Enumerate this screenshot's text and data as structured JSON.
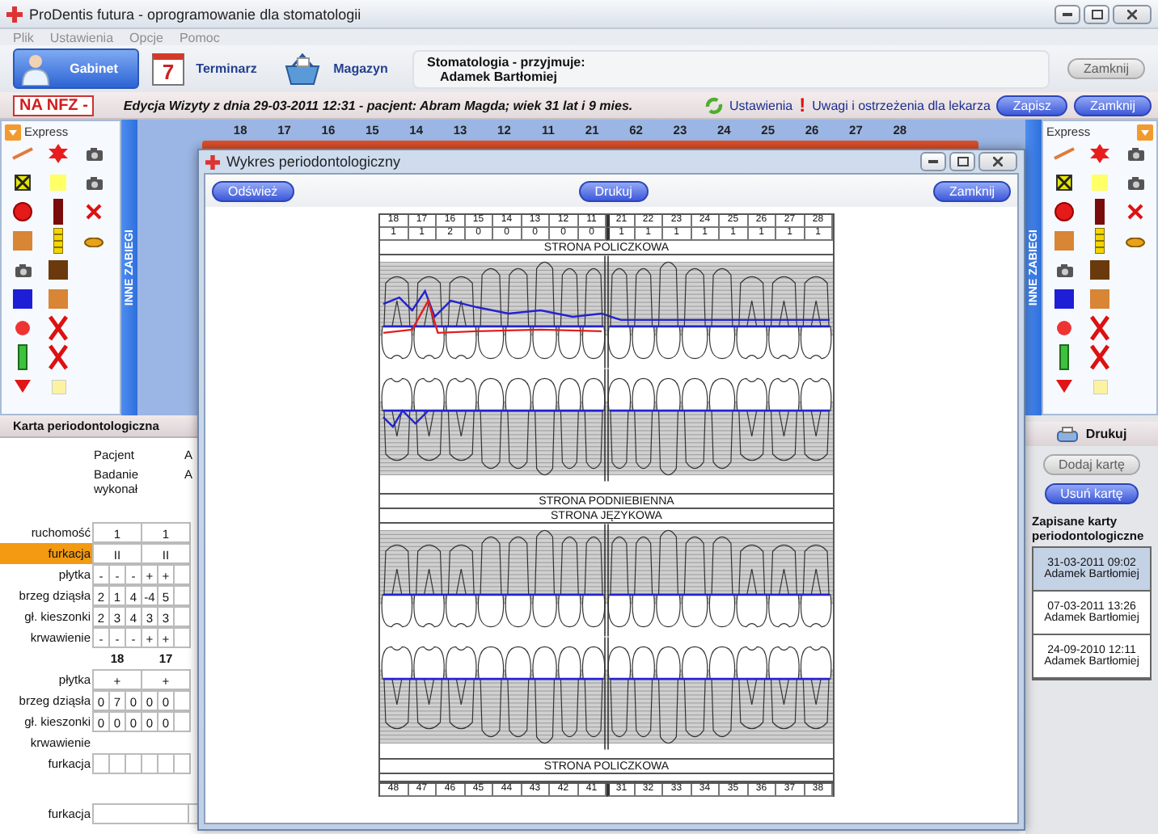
{
  "window": {
    "title": "ProDentis futura - oprogramowanie dla stomatologii"
  },
  "menu": [
    "Plik",
    "Ustawienia",
    "Opcje",
    "Pomoc"
  ],
  "modules": [
    {
      "label": "Gabinet",
      "kind": "doctor",
      "selected": true
    },
    {
      "label": "Terminarz",
      "kind": "calendar",
      "icon_text": "7",
      "selected": false
    },
    {
      "label": "Magazyn",
      "kind": "basket",
      "selected": false
    }
  ],
  "clinic": {
    "heading": "Stomatologia - przyjmuje:",
    "doctor": "Adamek Bartłomiej"
  },
  "close_button": {
    "label": "Zamknij",
    "disabled": true
  },
  "visit_bar": {
    "badge": "NA NFZ -",
    "title": "Edycja Wizyty z dnia 29-03-2011 12:31 - pacjent: Abram Magda; wiek 31 lat i 9 mies.",
    "settings": "Ustawienia",
    "warning_mark": "!",
    "warnings": "Uwagi i ostrzeżenia dla lekarza",
    "buttons": [
      "Zapisz",
      "Zamknij"
    ]
  },
  "left_panel": {
    "palette_title": "Express",
    "side_tab": "INNE ZABIEGI"
  },
  "tooth_numbers": [
    "18",
    "17",
    "16",
    "15",
    "14",
    "13",
    "12",
    "11",
    "21",
    "62",
    "23",
    "24",
    "25",
    "26",
    "27",
    "28"
  ],
  "card": {
    "title": "Karta periodontologiczna",
    "patient_label": "Pacjent",
    "patient_value": "A",
    "examiner_label": "Badanie wykonał",
    "examiner_value": "A",
    "rows": [
      {
        "label": "ruchomość",
        "kind": "merged",
        "highlighted": false,
        "cells": [
          "1",
          "1"
        ]
      },
      {
        "label": "furkacja",
        "kind": "merged",
        "highlighted": true,
        "cells": [
          "II",
          "II"
        ]
      },
      {
        "label": "płytka",
        "kind": "split",
        "highlighted": false,
        "cells": [
          "-",
          "-",
          "-",
          "+",
          "+"
        ]
      },
      {
        "label": "brzeg dziąsła",
        "kind": "split",
        "highlighted": false,
        "cells": [
          "2",
          "1",
          "4",
          "-4",
          "5"
        ]
      },
      {
        "label": "gł. kieszonki",
        "kind": "split",
        "highlighted": false,
        "cells": [
          "2",
          "3",
          "4",
          "3",
          "3"
        ]
      },
      {
        "label": "krwawienie",
        "kind": "split",
        "highlighted": false,
        "cells": [
          "-",
          "-",
          "-",
          "+",
          "+"
        ]
      },
      {
        "kind": "header",
        "highlighted": false,
        "cells": [
          "18",
          "17"
        ]
      },
      {
        "label": "płytka",
        "kind": "merged",
        "highlighted": false,
        "cells": [
          "+",
          "+"
        ]
      },
      {
        "label": "brzeg dziąsła",
        "kind": "split",
        "highlighted": false,
        "cells": [
          "0",
          "7",
          "0",
          "0",
          "0"
        ]
      },
      {
        "label": "gł. kieszonki",
        "kind": "split",
        "highlighted": false,
        "cells": [
          "0",
          "0",
          "0",
          "0",
          "0"
        ]
      },
      {
        "label": "krwawienie",
        "kind": "blank",
        "highlighted": false
      },
      {
        "label": "furkacja",
        "kind": "split",
        "highlighted": false
      }
    ],
    "footer_row": {
      "label": "furkacja"
    }
  },
  "dialog": {
    "title": "Wykres periodontologiczny",
    "buttons": [
      "Odśwież",
      "Drukuj",
      "Zamknij"
    ],
    "upper_numbers": [
      "18",
      "17",
      "16",
      "15",
      "14",
      "13",
      "12",
      "11",
      "21",
      "22",
      "23",
      "24",
      "25",
      "26",
      "27",
      "28"
    ],
    "upper_values": [
      "1",
      "1",
      "2",
      "0",
      "0",
      "0",
      "0",
      "0",
      "1",
      "1",
      "1",
      "1",
      "1",
      "1",
      "1",
      "1"
    ],
    "labels": [
      "STRONA POLICZKOWA",
      "STRONA PODNIEBIENNA",
      "STRONA JĘZYKOWA",
      "STRONA POLICZKOWA"
    ],
    "lower_numbers": [
      "48",
      "47",
      "46",
      "45",
      "44",
      "43",
      "42",
      "41",
      "31",
      "32",
      "33",
      "34",
      "35",
      "36",
      "37",
      "38"
    ]
  },
  "right_panel": {
    "palette_title": "Express",
    "side_tab": "INNE ZABIEGI",
    "print": "Drukuj",
    "buttons": [
      {
        "label": "Dodaj kartę",
        "disabled": true
      },
      {
        "label": "Usuń kartę",
        "disabled": false
      }
    ],
    "saved_title": "Zapisane karty periodontologiczne",
    "saved": [
      {
        "date": "31-03-2011 09:02",
        "doctor": "Adamek Bartłomiej",
        "selected": true
      },
      {
        "date": "07-03-2011 13:26",
        "doctor": "Adamek Bartłomiej",
        "selected": false
      },
      {
        "date": "24-09-2010 12:11",
        "doctor": "Adamek Bartłomiej",
        "selected": false
      }
    ]
  }
}
